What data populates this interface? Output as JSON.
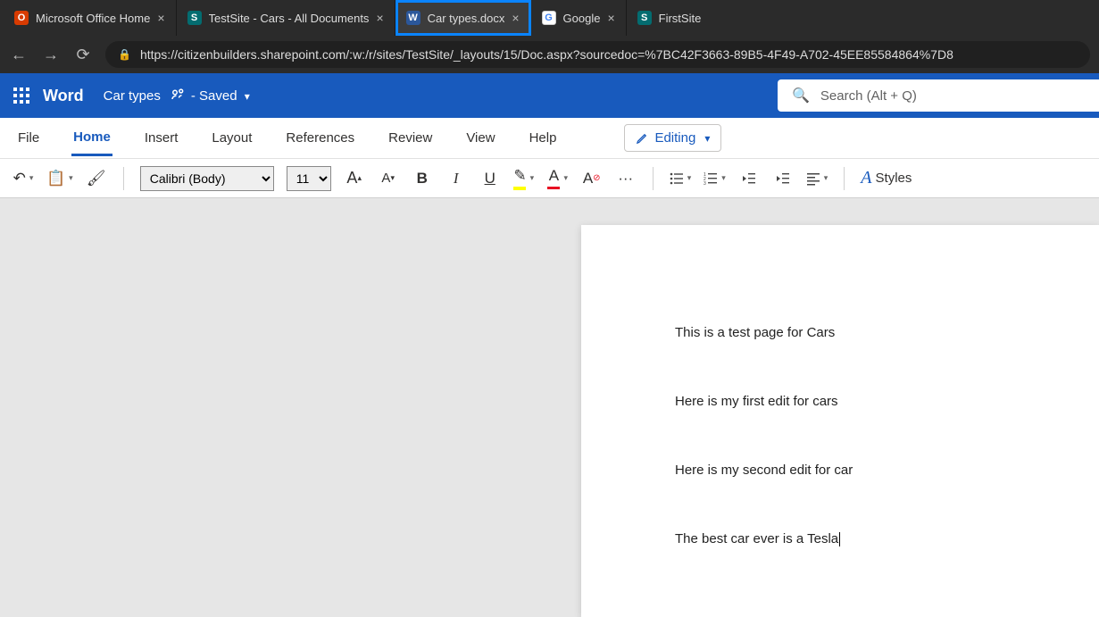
{
  "browser": {
    "tabs": [
      {
        "title": "Microsoft Office Home",
        "favicon_letter": "O",
        "fav_class": "fav-office"
      },
      {
        "title": "TestSite - Cars - All Documents",
        "favicon_letter": "S",
        "fav_class": "fav-sp"
      },
      {
        "title": "Car types.docx",
        "favicon_letter": "W",
        "fav_class": "fav-word"
      },
      {
        "title": "Google",
        "favicon_letter": "G",
        "fav_class": "fav-google"
      },
      {
        "title": "FirstSite",
        "favicon_letter": "S",
        "fav_class": "fav-sp"
      }
    ],
    "url": "https://citizenbuilders.sharepoint.com/:w:/r/sites/TestSite/_layouts/15/Doc.aspx?sourcedoc=%7BC42F3663-89B5-4F49-A702-45EE85584864%7D8"
  },
  "word": {
    "app_name": "Word",
    "doc_title": "Car types",
    "save_state": "- Saved",
    "search_placeholder": "Search (Alt + Q)",
    "ribbon_tabs": [
      "File",
      "Home",
      "Insert",
      "Layout",
      "References",
      "Review",
      "View",
      "Help"
    ],
    "active_tab": "Home",
    "mode_label": "Editing",
    "font_name": "Calibri (Body)",
    "font_size": "11",
    "styles_label": "Styles"
  },
  "document": {
    "paragraphs": [
      "This is a test page for Cars",
      "Here is my first edit for cars",
      "Here is my second edit for car",
      "The best car ever is a Tesla"
    ]
  }
}
